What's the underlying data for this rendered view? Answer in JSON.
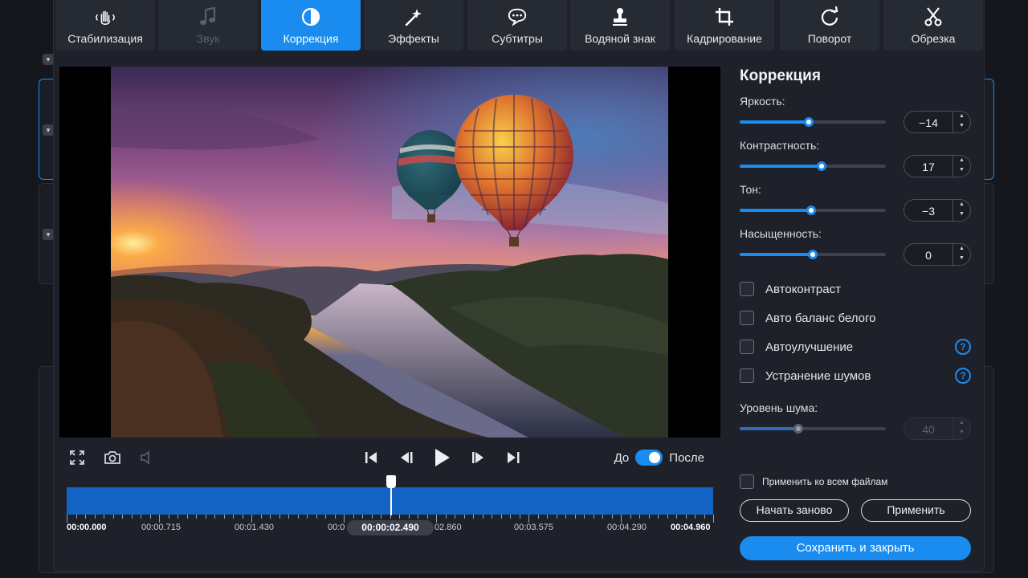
{
  "tabs": [
    {
      "label": "Стабилизация",
      "icon": "hand-stabilize-icon"
    },
    {
      "label": "Звук",
      "icon": "music-note-icon"
    },
    {
      "label": "Коррекция",
      "icon": "half-circle-correction-icon"
    },
    {
      "label": "Эффекты",
      "icon": "magic-wand-icon"
    },
    {
      "label": "Субтитры",
      "icon": "speech-bubble-icon"
    },
    {
      "label": "Водяной знак",
      "icon": "stamp-icon"
    },
    {
      "label": "Кадрирование",
      "icon": "crop-icon"
    },
    {
      "label": "Поворот",
      "icon": "rotate-icon"
    },
    {
      "label": "Обрезка",
      "icon": "scissors-icon"
    }
  ],
  "active_tab": "Коррекция",
  "disabled_tab": "Звук",
  "preview": {
    "image": "hot-air-balloons-over-river-valley-sunset"
  },
  "player": {
    "before_label": "До",
    "after_label": "После",
    "before_after_enabled": true,
    "current_time": "00:00:02.490",
    "position_fraction": 0.5
  },
  "timeline": {
    "labels": [
      "00:00.000",
      "00:00.715",
      "00:01.430",
      "00:0",
      "02.860",
      "00:03.575",
      "00:04.290",
      "00:04.960"
    ]
  },
  "panel": {
    "title": "Коррекция",
    "sliders": [
      {
        "label": "Яркость:",
        "value": "−14",
        "level": 0.47
      },
      {
        "label": "Контрастность:",
        "value": "17",
        "level": 0.56
      },
      {
        "label": "Тон:",
        "value": "−3",
        "level": 0.49
      },
      {
        "label": "Насыщенность:",
        "value": "0",
        "level": 0.5
      }
    ],
    "checkboxes": [
      {
        "label": "Автоконтраст",
        "checked": false,
        "help": false
      },
      {
        "label": "Авто баланс белого",
        "checked": false,
        "help": false
      },
      {
        "label": "Автоулучшение",
        "checked": false,
        "help": true
      },
      {
        "label": "Устранение шумов",
        "checked": false,
        "help": true
      }
    ],
    "noise": {
      "label": "Уровень шума:",
      "value": "40",
      "level": 0.4,
      "disabled": true
    },
    "apply_all_label": "Применить ко всем файлам",
    "reset_label": "Начать заново",
    "apply_label": "Применить",
    "save_label": "Сохранить и закрыть",
    "help_glyph": "?"
  },
  "colors": {
    "accent": "#1a8cf0",
    "timeline": "#1364c4",
    "panel_bg": "#1e2129"
  }
}
